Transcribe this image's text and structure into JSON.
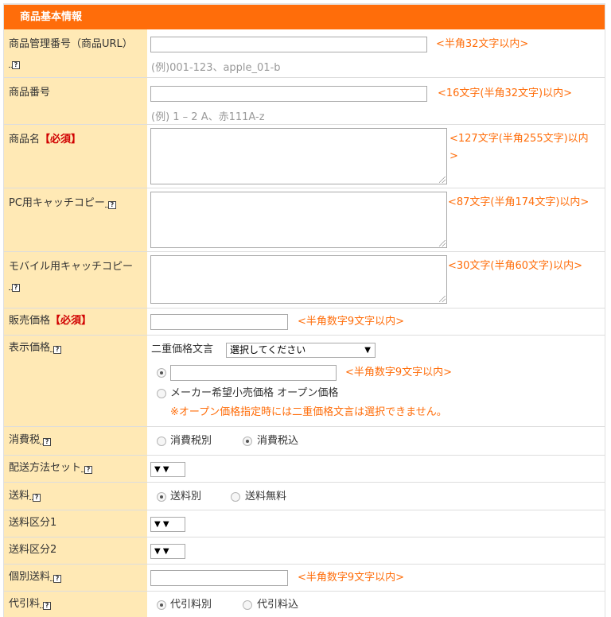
{
  "section": {
    "title": "商品基本情報"
  },
  "fields": {
    "management_no": {
      "label": "商品管理番号（商品URL）",
      "note": "<半角32文字以内>",
      "example": "(例)001-123、apple_01-b",
      "value": ""
    },
    "product_no": {
      "label": "商品番号",
      "note": "<16文字(半角32文字)以内>",
      "example": "(例) 1 – 2 A、赤111A-z",
      "value": ""
    },
    "product_name": {
      "label": "商品名",
      "required": "【必須】",
      "note": "<127文字(半角255文字)以内>",
      "value": ""
    },
    "pc_catch": {
      "label": "PC用キャッチコピー",
      "note": "<87文字(半角174文字)以内>",
      "value": ""
    },
    "mobile_catch": {
      "label": "モバイル用キャッチコピー",
      "note": "<30文字(半角60文字)以内>",
      "value": ""
    },
    "price": {
      "label": "販売価格",
      "required": "【必須】",
      "note": "<半角数字9文字以内>",
      "value": ""
    },
    "display_price": {
      "label": "表示価格",
      "double_price_label": "二重価格文言",
      "double_price_select": "選択してください",
      "note": "<半角数字9文字以内>",
      "value": "",
      "option_open_price": "メーカー希望小売価格 オープン価格",
      "warning": "※オープン価格指定時には二重価格文言は選択できません。",
      "selected": "custom"
    },
    "tax": {
      "label": "消費税",
      "options": [
        "消費税別",
        "消費税込"
      ],
      "selected": "消費税込"
    },
    "shipping_set": {
      "label": "配送方法セット",
      "select": "▼"
    },
    "shipping": {
      "label": "送料",
      "options": [
        "送料別",
        "送料無料"
      ],
      "selected": "送料別"
    },
    "shipping_cat1": {
      "label": "送料区分1",
      "select": "▼"
    },
    "shipping_cat2": {
      "label": "送料区分2",
      "select": "▼"
    },
    "individual_shipping": {
      "label": "個別送料",
      "note": "<半角数字9文字以内>",
      "value": ""
    },
    "cod_fee": {
      "label": "代引料",
      "options": [
        "代引料別",
        "代引料込"
      ],
      "selected": "代引料別"
    }
  },
  "help_icon": "?",
  "colors": {
    "header": "#ff6d0a",
    "label_bg": "#ffe9b5",
    "note": "#ff6d0a",
    "required": "#d00000"
  }
}
